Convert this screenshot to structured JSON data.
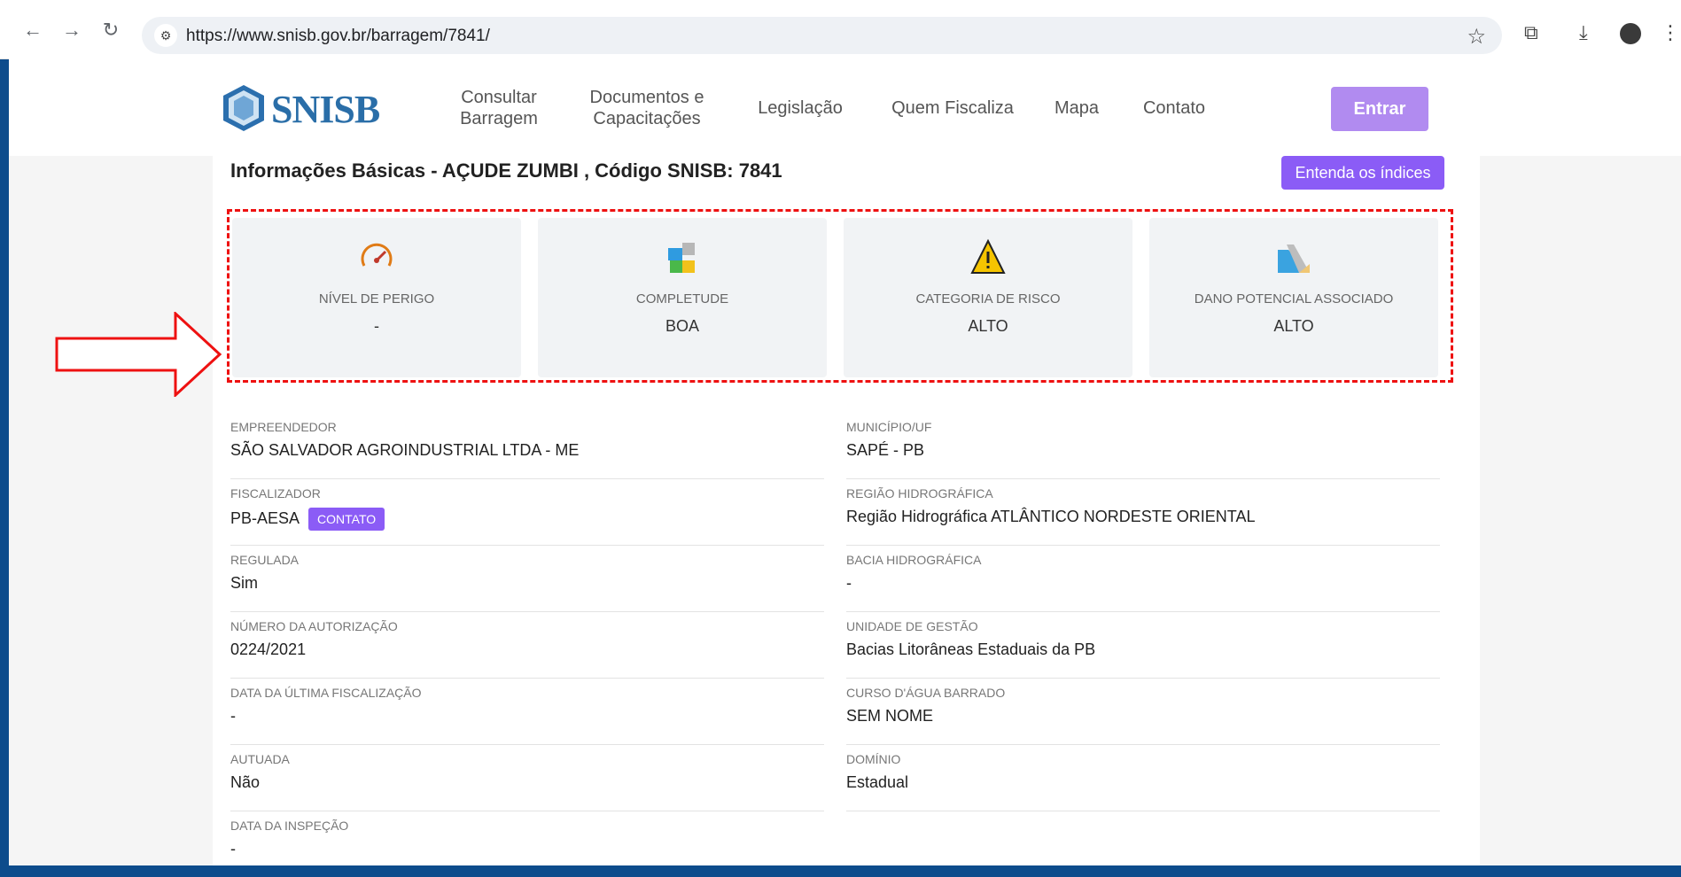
{
  "browser": {
    "url": "https://www.snisb.gov.br/barragem/7841/"
  },
  "header": {
    "logo_text": "SNISB",
    "menu": [
      {
        "line1": "Consultar",
        "line2": "Barragem"
      },
      {
        "line1": "Documentos e",
        "line2": "Capacitações"
      },
      {
        "label": "Legislação"
      },
      {
        "label": "Quem Fiscaliza"
      },
      {
        "label": "Mapa"
      },
      {
        "label": "Contato"
      }
    ],
    "login_label": "Entrar"
  },
  "main": {
    "title": "Informações Básicas - AÇUDE ZUMBI , Código SNISB: 7841",
    "indices_button": "Entenda os índices",
    "cards": [
      {
        "icon": "speedometer-icon",
        "label": "NÍVEL DE PERIGO",
        "value": "-"
      },
      {
        "icon": "puzzle-icon",
        "label": "COMPLETUDE",
        "value": "BOA"
      },
      {
        "icon": "warning-icon",
        "label": "CATEGORIA DE RISCO",
        "value": "ALTO"
      },
      {
        "icon": "dam-icon",
        "label": "DANO POTENCIAL ASSOCIADO",
        "value": "ALTO"
      }
    ],
    "left_fields": [
      {
        "label": "EMPREENDEDOR",
        "value": "SÃO SALVADOR AGROINDUSTRIAL LTDA - ME"
      },
      {
        "label": "FISCALIZADOR",
        "value": "PB-AESA",
        "badge": "CONTATO"
      },
      {
        "label": "REGULADA",
        "value": "Sim"
      },
      {
        "label": "NÚMERO DA AUTORIZAÇÃO",
        "value": "0224/2021"
      },
      {
        "label": "DATA DA ÚLTIMA FISCALIZAÇÃO",
        "value": "-"
      },
      {
        "label": "AUTUADA",
        "value": "Não"
      },
      {
        "label": "DATA DA INSPEÇÃO",
        "value": "-"
      }
    ],
    "right_fields": [
      {
        "label": "MUNICÍPIO/UF",
        "value": "SAPÉ - PB"
      },
      {
        "label": "REGIÃO HIDROGRÁFICA",
        "value": "Região Hidrográfica ATLÂNTICO NORDESTE ORIENTAL"
      },
      {
        "label": "BACIA HIDROGRÁFICA",
        "value": "-"
      },
      {
        "label": "UNIDADE DE GESTÃO",
        "value": "Bacias Litorâneas Estaduais da PB"
      },
      {
        "label": "CURSO D'ÁGUA BARRADO",
        "value": "SEM NOME"
      },
      {
        "label": "DOMÍNIO",
        "value": "Estadual"
      }
    ]
  }
}
